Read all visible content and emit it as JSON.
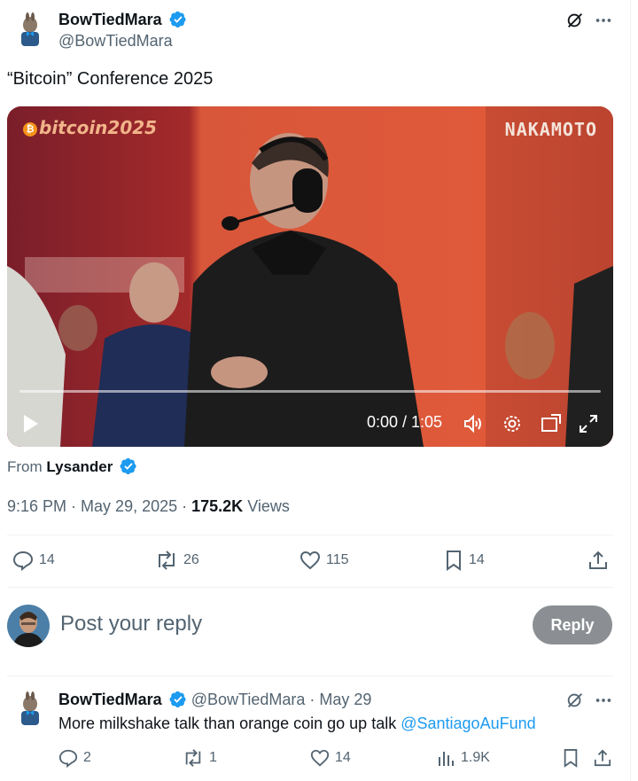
{
  "tweet": {
    "author_name": "BowTiedMara",
    "author_handle": "@BowTiedMara",
    "text": "“Bitcoin” Conference 2025",
    "video": {
      "overlay_logo": "bitcoin2025",
      "overlay_brand": "NAKAMOTO",
      "time_display": "0:00 / 1:05",
      "progress_fraction": 0
    },
    "from_prefix": "From",
    "from_name": "Lysander",
    "time": "9:16 PM",
    "date": "May 29, 2025",
    "views_count": "175.2K",
    "views_label": "Views",
    "stats": {
      "replies": "14",
      "reposts": "26",
      "likes": "115",
      "bookmarks": "14"
    }
  },
  "reply_composer": {
    "placeholder": "Post your reply",
    "button_label": "Reply"
  },
  "reply": {
    "author_name": "BowTiedMara",
    "author_handle": "@BowTiedMara",
    "date": "May 29",
    "text": "More milkshake talk than orange coin go up talk",
    "mention": "@SantiagoAuFund",
    "stats": {
      "replies": "2",
      "reposts": "1",
      "likes": "14",
      "views": "1.9K"
    }
  },
  "colors": {
    "verified": "#1d9bf0",
    "muted": "#536471",
    "link": "#1d9bf0",
    "reply_button": "#8b8f93"
  },
  "icons": [
    "grok-icon",
    "more-icon",
    "verified-badge-icon",
    "play-icon",
    "volume-icon",
    "settings-icon",
    "pip-icon",
    "fullscreen-icon",
    "reply-icon",
    "repost-icon",
    "like-icon",
    "bookmark-icon",
    "share-icon",
    "analytics-icon"
  ]
}
